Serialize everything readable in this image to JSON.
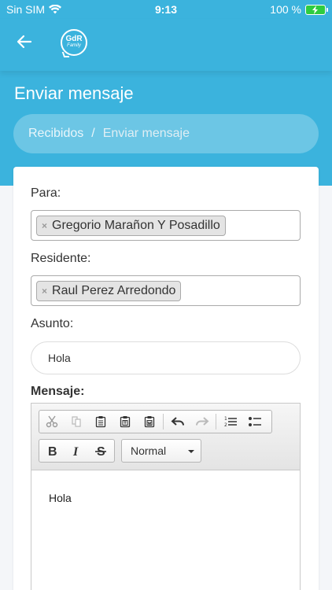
{
  "status": {
    "carrier": "Sin SIM",
    "time": "9:13",
    "battery": "100 %"
  },
  "page": {
    "title": "Enviar mensaje"
  },
  "breadcrumb": {
    "items": [
      "Recibidos",
      "Enviar mensaje"
    ],
    "separator": "/"
  },
  "form": {
    "para_label": "Para:",
    "para_tag": "Gregorio Marañon Y Posadillo",
    "residente_label": "Residente:",
    "residente_tag": "Raul Perez Arredondo",
    "asunto_label": "Asunto:",
    "asunto_value": "Hola",
    "mensaje_label": "Mensaje:",
    "tag_remove": "×"
  },
  "editor": {
    "format_select": "Normal",
    "content": "Hola"
  },
  "colors": {
    "primary": "#3bb3dd",
    "background": "#f4f6f9"
  },
  "logo": {
    "text": "GdR",
    "subtext": "Family"
  }
}
